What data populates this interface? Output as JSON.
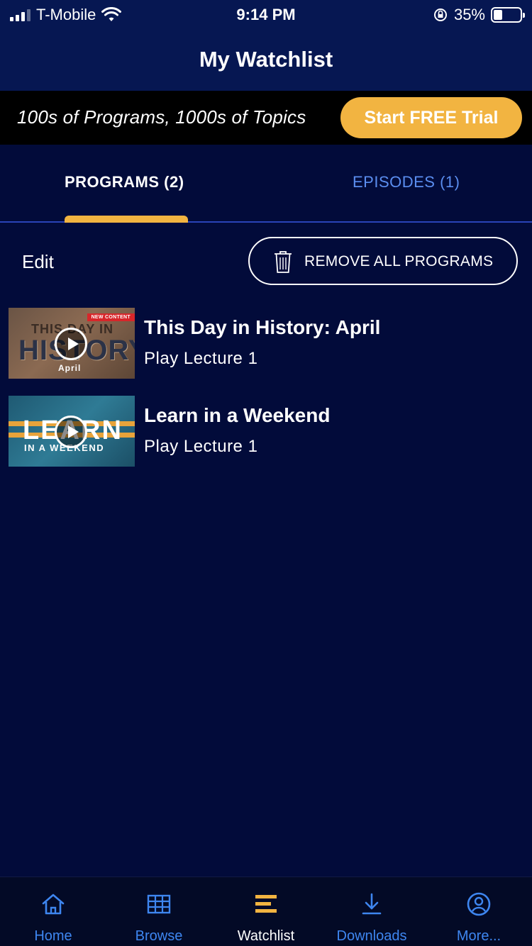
{
  "status_bar": {
    "carrier": "T-Mobile",
    "time": "9:14 PM",
    "battery": "35%"
  },
  "header": {
    "title": "My Watchlist"
  },
  "promo": {
    "text": "100s of Programs, 1000s of Topics",
    "cta_label": "Start FREE Trial"
  },
  "tabs": [
    {
      "label": "PROGRAMS (2)",
      "active": true
    },
    {
      "label": "EPISODES (1)",
      "active": false
    }
  ],
  "actions": {
    "edit_label": "Edit",
    "remove_all_label": "REMOVE ALL PROGRAMS"
  },
  "items": [
    {
      "title": "This Day in History: April",
      "subtitle": "Play Lecture 1",
      "thumb_badge": "NEW CONTENT",
      "thumb_line1": "THIS DAY IN",
      "thumb_line2": "HISTORY",
      "thumb_sub": "April"
    },
    {
      "title": "Learn in a Weekend",
      "subtitle": "Play Lecture 1",
      "thumb_line1": "LEARN",
      "thumb_line2": "IN A WEEKEND"
    }
  ],
  "bottom_nav": [
    {
      "label": "Home",
      "icon": "home-icon"
    },
    {
      "label": "Browse",
      "icon": "grid-icon"
    },
    {
      "label": "Watchlist",
      "icon": "watchlist-icon",
      "active": true
    },
    {
      "label": "Downloads",
      "icon": "download-icon"
    },
    {
      "label": "More...",
      "icon": "profile-icon"
    }
  ],
  "colors": {
    "background": "#020b3a",
    "header": "#061752",
    "accent": "#f2b441",
    "link_blue": "#3e86f0"
  }
}
